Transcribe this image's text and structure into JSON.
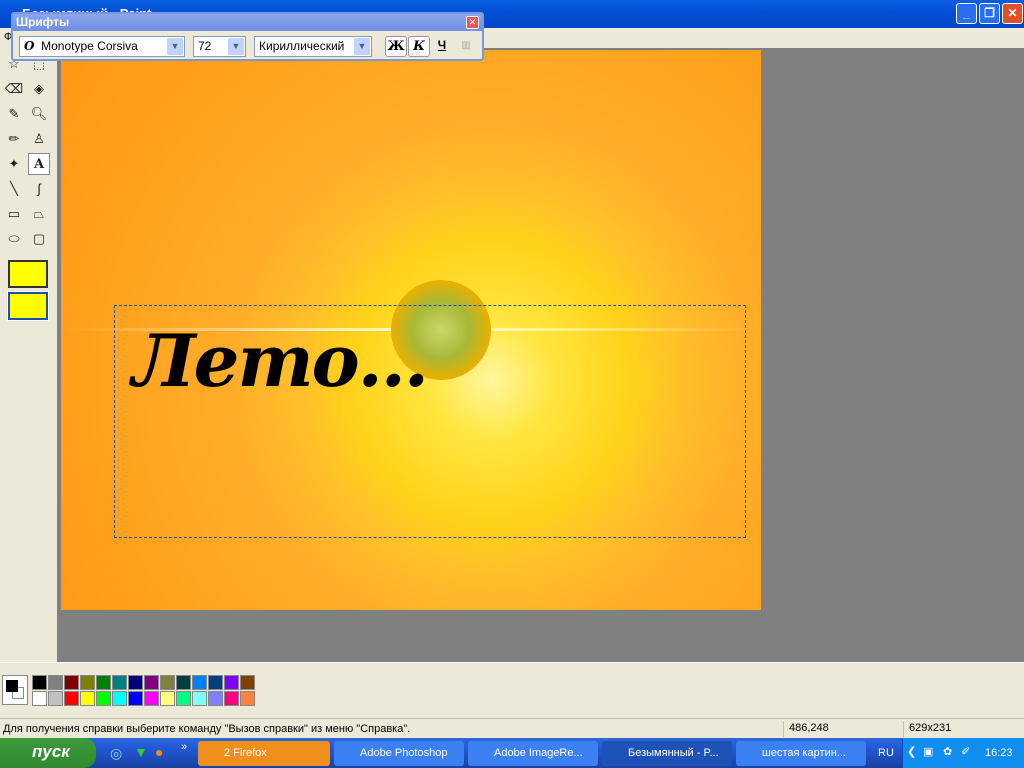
{
  "window": {
    "title": "Безымянный - Paint",
    "menu_first": "Ф"
  },
  "font_toolbar": {
    "title": "Шрифты",
    "font": "Monotype Corsiva",
    "size": "72",
    "script": "Кириллический",
    "bold": "Ж",
    "italic": "К",
    "underline": "Ч"
  },
  "canvas": {
    "text": "Лето..."
  },
  "palette": {
    "foreground": "#000000",
    "background": "#ffffff",
    "colors_top": [
      "#000000",
      "#808080",
      "#800000",
      "#808000",
      "#008000",
      "#008080",
      "#000080",
      "#800080",
      "#808040",
      "#004040",
      "#0080ff",
      "#004080",
      "#8000ff",
      "#804000"
    ],
    "colors_bottom": [
      "#ffffff",
      "#c0c0c0",
      "#ff0000",
      "#ffff00",
      "#00ff00",
      "#00ffff",
      "#0000ff",
      "#ff00ff",
      "#ffff80",
      "#00ff80",
      "#80ffff",
      "#8080ff",
      "#ff0080",
      "#ff8040"
    ]
  },
  "status": {
    "help": "Для получения справки выберите команду \"Вызов справки\" из меню \"Справка\".",
    "coords": "486,248",
    "size": "629x231"
  },
  "taskbar": {
    "start": "пуск",
    "tasks": [
      {
        "label": "2 Firefox"
      },
      {
        "label": "Adobe Photoshop"
      },
      {
        "label": "Adobe ImageRe..."
      },
      {
        "label": "Безымянный - P..."
      },
      {
        "label": "шестая картин..."
      }
    ],
    "lang": "RU",
    "time": "16:23"
  }
}
